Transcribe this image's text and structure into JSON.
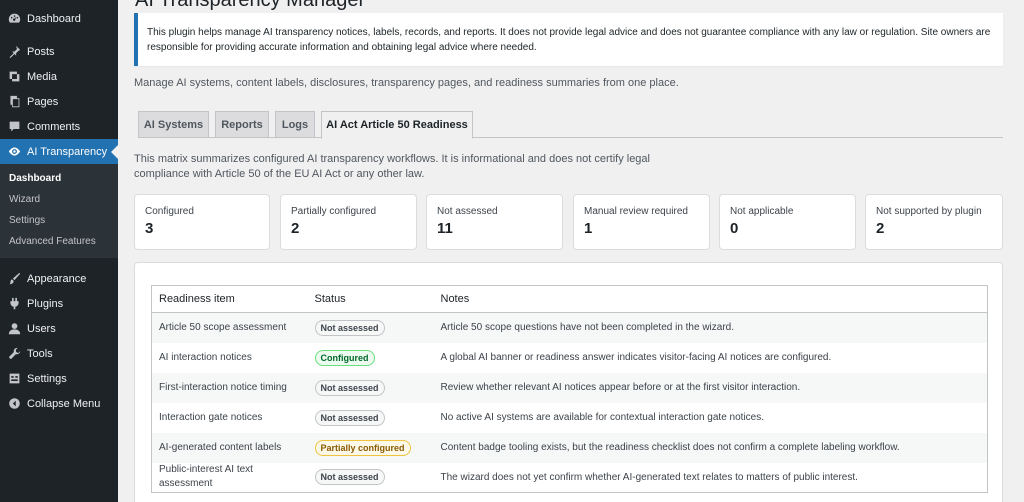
{
  "sidebar": {
    "items_top": [
      {
        "label": "Dashboard",
        "icon": "dashboard-icon"
      },
      {
        "label": "Posts",
        "icon": "pin-icon"
      },
      {
        "label": "Media",
        "icon": "media-icon"
      },
      {
        "label": "Pages",
        "icon": "pages-icon"
      },
      {
        "label": "Comments",
        "icon": "comment-icon"
      },
      {
        "label": "AI Transparency",
        "icon": "eye-icon"
      }
    ],
    "submenu": [
      "Dashboard",
      "Wizard",
      "Settings",
      "Advanced Features"
    ],
    "items_bottom": [
      {
        "label": "Appearance",
        "icon": "brush-icon"
      },
      {
        "label": "Plugins",
        "icon": "plug-icon"
      },
      {
        "label": "Users",
        "icon": "user-icon"
      },
      {
        "label": "Tools",
        "icon": "wrench-icon"
      },
      {
        "label": "Settings",
        "icon": "settings-icon"
      },
      {
        "label": "Collapse Menu",
        "icon": "collapse-icon"
      }
    ]
  },
  "page": {
    "title": "AI Transparency Manager",
    "notice": "This plugin helps manage AI transparency notices, labels, records, and reports. It does not provide legal advice and does not guarantee compliance with any law or regulation. Site owners are responsible for providing accurate information and obtaining legal advice where needed.",
    "description": "Manage AI systems, content labels, disclosures, transparency pages, and readiness summaries from one place."
  },
  "tabs": [
    "AI Systems",
    "Reports",
    "Logs",
    "AI Act Article 50 Readiness"
  ],
  "matrix_description": "This matrix summarizes configured AI transparency workflows. It is informational and does not certify legal compliance with Article 50 of the EU AI Act or any other law.",
  "summary_cards": [
    {
      "label": "Configured",
      "value": "3"
    },
    {
      "label": "Partially configured",
      "value": "2"
    },
    {
      "label": "Not assessed",
      "value": "11"
    },
    {
      "label": "Manual review required",
      "value": "1"
    },
    {
      "label": "Not applicable",
      "value": "0"
    },
    {
      "label": "Not supported by plugin",
      "value": "2"
    }
  ],
  "table": {
    "headers": [
      "Readiness item",
      "Status",
      "Notes"
    ],
    "rows": [
      {
        "item": "Article 50 scope assessment",
        "status": "Not assessed",
        "notes": "Article 50 scope questions have not been completed in the wizard."
      },
      {
        "item": "AI interaction notices",
        "status": "Configured",
        "notes": "A global AI banner or readiness answer indicates visitor-facing AI notices are configured."
      },
      {
        "item": "First-interaction notice timing",
        "status": "Not assessed",
        "notes": "Review whether relevant AI notices appear before or at the first visitor interaction."
      },
      {
        "item": "Interaction gate notices",
        "status": "Not assessed",
        "notes": "No active AI systems are available for contextual interaction gate notices."
      },
      {
        "item": "AI-generated content labels",
        "status": "Partially configured",
        "notes": "Content badge tooling exists, but the readiness checklist does not confirm a complete labeling workflow."
      },
      {
        "item": "Public-interest AI text assessment",
        "status": "Not assessed",
        "notes": "The wizard does not yet confirm whether AI-generated text relates to matters of public interest."
      }
    ]
  }
}
